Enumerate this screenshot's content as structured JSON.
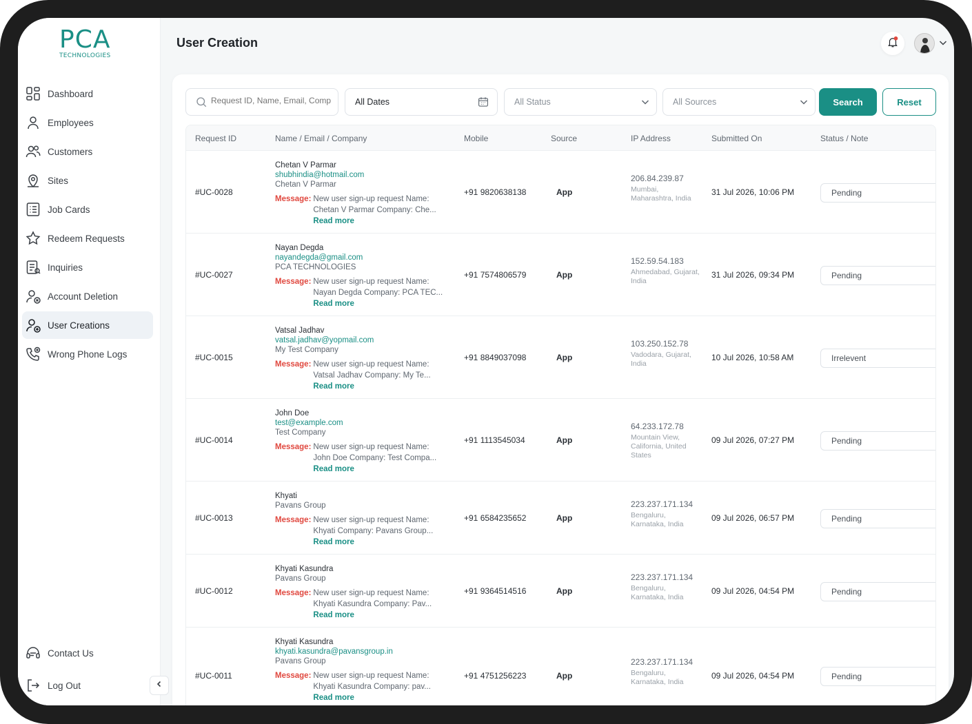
{
  "brand": {
    "name": "PCA",
    "sub": "TECHNOLOGIES",
    "color": "#1a8f85"
  },
  "page": {
    "title": "User Creation"
  },
  "sidebar": {
    "items": [
      {
        "label": "Dashboard",
        "icon": "dashboard-icon"
      },
      {
        "label": "Employees",
        "icon": "user-icon"
      },
      {
        "label": "Customers",
        "icon": "users-icon"
      },
      {
        "label": "Sites",
        "icon": "location-icon"
      },
      {
        "label": "Job Cards",
        "icon": "list-icon"
      },
      {
        "label": "Redeem Requests",
        "icon": "star-icon"
      },
      {
        "label": "Inquiries",
        "icon": "document-icon"
      },
      {
        "label": "Account Deletion",
        "icon": "user-remove-icon"
      },
      {
        "label": "User Creations",
        "icon": "user-add-icon",
        "active": true
      },
      {
        "label": "Wrong Phone Logs",
        "icon": "phone-icon"
      }
    ],
    "contact": "Contact Us",
    "logout": "Log Out"
  },
  "filters": {
    "search_placeholder": "Request ID, Name, Email, Comp",
    "dates": "All Dates",
    "status": "All Status",
    "sources": "All Sources",
    "search_btn": "Search",
    "reset_btn": "Reset"
  },
  "table": {
    "columns": [
      "Request ID",
      "Name / Email / Company",
      "Mobile",
      "Source",
      "IP Address",
      "Submitted On",
      "Status / Note"
    ],
    "message_label": "Message:",
    "read_more": "Read more",
    "rows": [
      {
        "id": "#UC-0028",
        "name": "Chetan V Parmar",
        "email": "shubhindia@hotmail.com",
        "company": "Chetan V Parmar",
        "msg1": "New user sign-up request Name:",
        "msg2": "Chetan V Parmar Company: Che...",
        "mobile": "+91 9820638138",
        "source": "App",
        "ip": "206.84.239.87",
        "loc": "Mumbai, Maharashtra, India",
        "submitted": "31 Jul 2026, 10:06 PM",
        "status": "Pending"
      },
      {
        "id": "#UC-0027",
        "name": "Nayan Degda",
        "email": "nayandegda@gmail.com",
        "company": "PCA TECHNOLOGIES",
        "msg1": "New user sign-up request Name:",
        "msg2": "Nayan Degda Company: PCA TEC...",
        "mobile": "+91 7574806579",
        "source": "App",
        "ip": "152.59.54.183",
        "loc": "Ahmedabad, Gujarat, India",
        "submitted": "31 Jul 2026, 09:34 PM",
        "status": "Pending"
      },
      {
        "id": "#UC-0015",
        "name": "Vatsal Jadhav",
        "email": "vatsal.jadhav@yopmail.com",
        "company": "My Test Company",
        "msg1": "New user sign-up request Name:",
        "msg2": "Vatsal Jadhav Company: My Te...",
        "mobile": "+91 8849037098",
        "source": "App",
        "ip": "103.250.152.78",
        "loc": "Vadodara, Gujarat, India",
        "submitted": "10 Jul 2026, 10:58 AM",
        "status": "Irrelevent"
      },
      {
        "id": "#UC-0014",
        "name": "John Doe",
        "email": "test@example.com",
        "company": "Test Company",
        "msg1": "New user sign-up request Name:",
        "msg2": "John Doe Company: Test Compa...",
        "mobile": "+91 1113545034",
        "source": "App",
        "ip": "64.233.172.78",
        "loc": "Mountain View, California, United States",
        "submitted": "09 Jul 2026, 07:27 PM",
        "status": "Pending"
      },
      {
        "id": "#UC-0013",
        "name": "Khyati",
        "email": "",
        "company": "Pavans Group",
        "msg1": "New user sign-up request Name:",
        "msg2": "Khyati Company: Pavans Group...",
        "mobile": "+91 6584235652",
        "source": "App",
        "ip": "223.237.171.134",
        "loc": "Bengaluru, Karnataka, India",
        "submitted": "09 Jul 2026, 06:57 PM",
        "status": "Pending"
      },
      {
        "id": "#UC-0012",
        "name": "Khyati Kasundra",
        "email": "",
        "company": "Pavans Group",
        "msg1": "New user sign-up request Name:",
        "msg2": "Khyati Kasundra Company: Pav...",
        "mobile": "+91 9364514516",
        "source": "App",
        "ip": "223.237.171.134",
        "loc": "Bengaluru, Karnataka, India",
        "submitted": "09 Jul 2026, 04:54 PM",
        "status": "Pending"
      },
      {
        "id": "#UC-0011",
        "name": "Khyati Kasundra",
        "email": "khyati.kasundra@pavansgroup.in",
        "company": "Pavans Group",
        "msg1": "New user sign-up request Name:",
        "msg2": "Khyati Kasundra Company: pav...",
        "mobile": "+91 4751256223",
        "source": "App",
        "ip": "223.237.171.134",
        "loc": "Bengaluru, Karnataka, India",
        "submitted": "09 Jul 2026, 04:54 PM",
        "status": "Pending"
      }
    ]
  }
}
